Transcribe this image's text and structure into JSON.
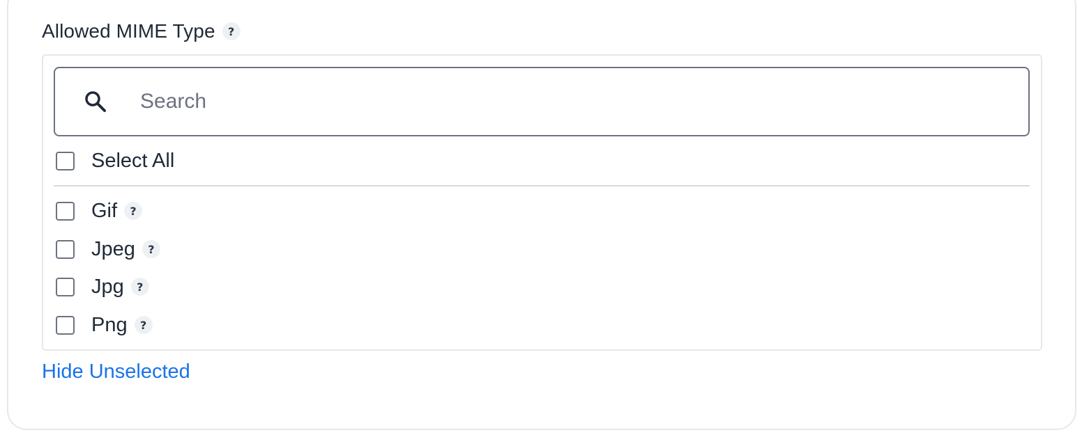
{
  "field": {
    "label": "Allowed MIME Type",
    "help": "?"
  },
  "search": {
    "placeholder": "Search",
    "value": ""
  },
  "select_all": {
    "label": "Select All",
    "checked": false
  },
  "options": [
    {
      "label": "Gif",
      "help": "?",
      "checked": false
    },
    {
      "label": "Jpeg",
      "help": "?",
      "checked": false
    },
    {
      "label": "Jpg",
      "help": "?",
      "checked": false
    },
    {
      "label": "Png",
      "help": "?",
      "checked": false
    }
  ],
  "toggle_link": "Hide Unselected"
}
